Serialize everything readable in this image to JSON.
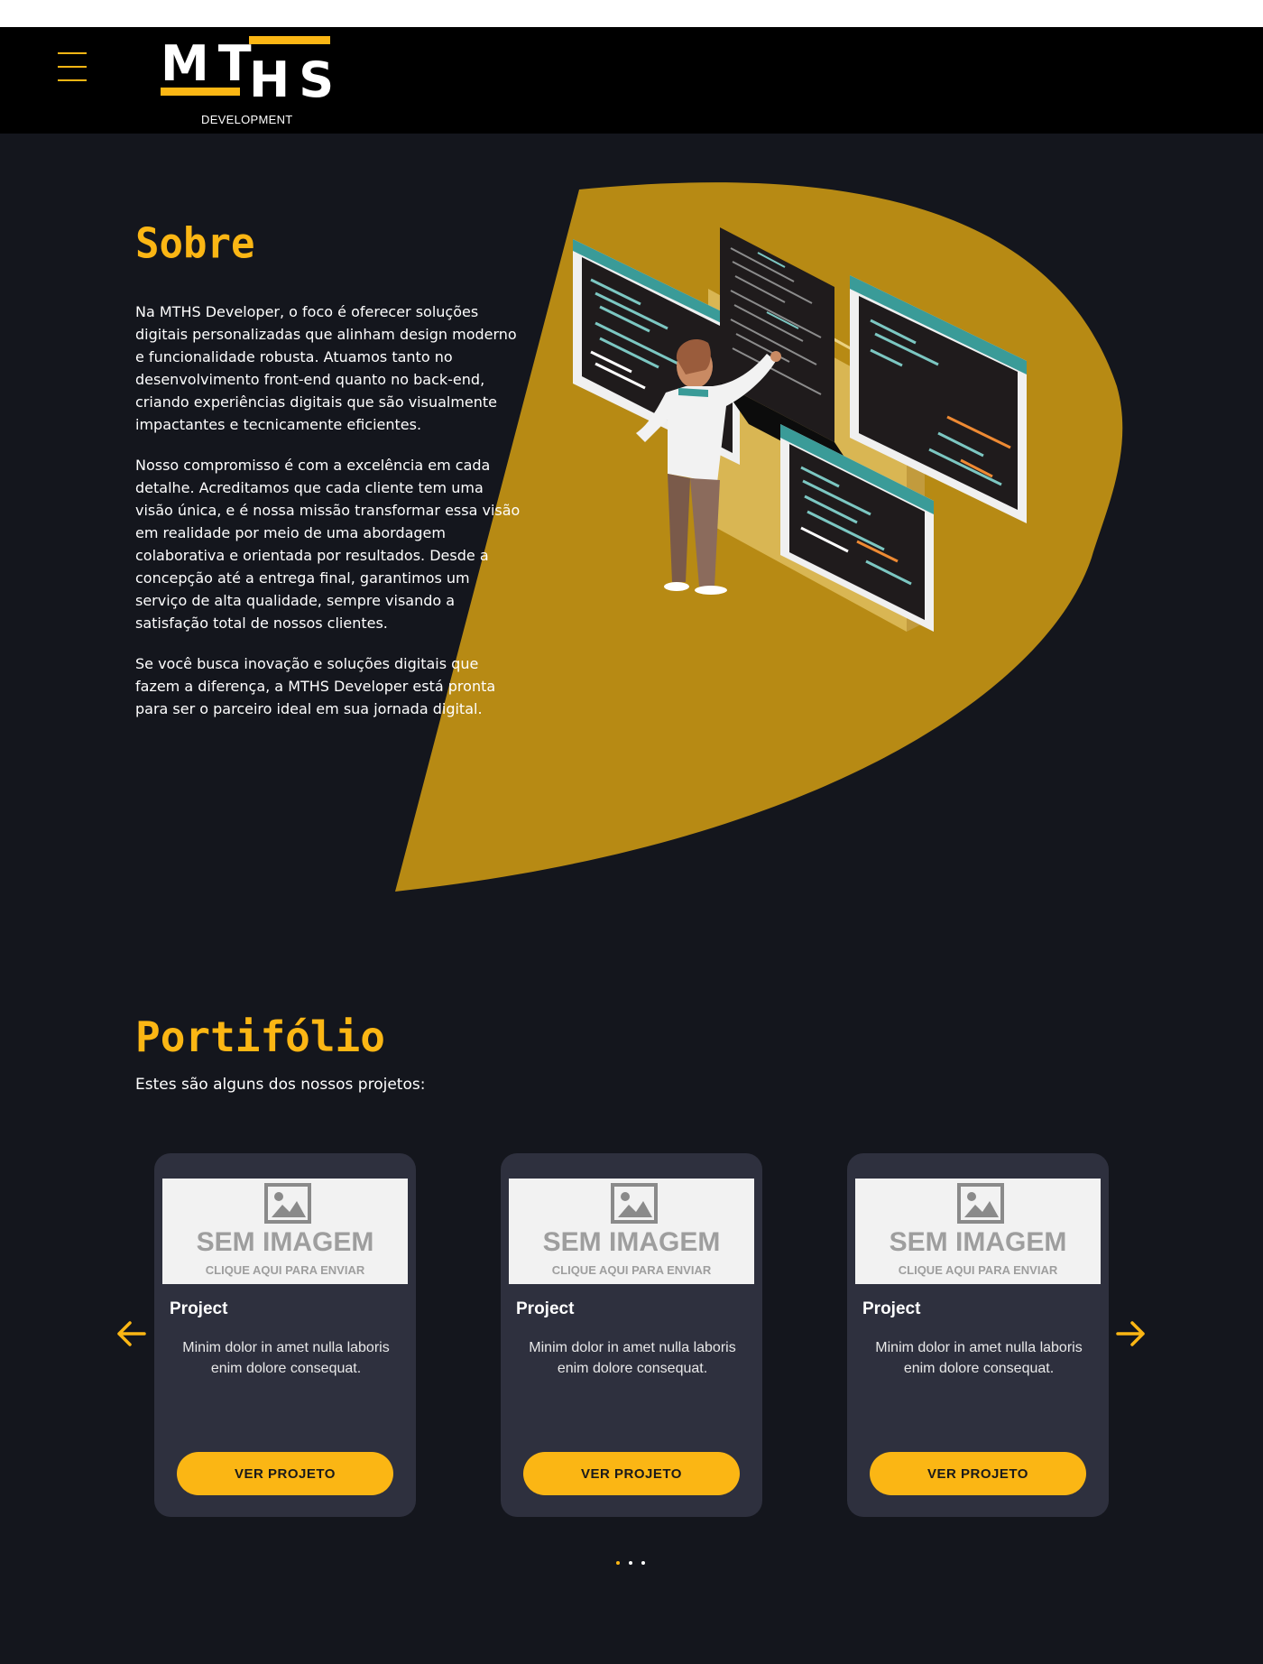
{
  "header": {
    "logo_mt": "MT",
    "logo_hs": "HS",
    "logo_subtitle": "DEVELOPMENT"
  },
  "sobre": {
    "title": "Sobre",
    "paragraphs": [
      "Na MTHS Developer, o foco é oferecer soluções digitais personalizadas que alinham design moderno e funcionalidade robusta. Atuamos tanto no desenvolvimento front-end quanto no back-end, criando experiências digitais que são visualmente impactantes e tecnicamente eficientes.",
      "Nosso compromisso é com a excelência em cada detalhe. Acreditamos que cada cliente tem uma visão única, e é nossa missão transformar essa visão em realidade por meio de uma abordagem colaborativa e orientada por resultados. Desde a concepção até a entrega final, garantimos um serviço de alta qualidade, sempre visando a satisfação total de nossos clientes.",
      "Se você busca inovação e soluções digitais que fazem a diferença, a MTHS Developer está pronta para ser o parceiro ideal em sua jornada digital."
    ]
  },
  "portfolio": {
    "title": "Portifólio",
    "subtitle": "Estes são alguns dos nossos projetos:",
    "cards": [
      {
        "image_title": "SEM IMAGEM",
        "image_sub": "CLIQUE AQUI PARA ENVIAR",
        "title": "Project",
        "desc": "Minim dolor in amet nulla laboris enim dolore consequat.",
        "button": "VER PROJETO"
      },
      {
        "image_title": "SEM IMAGEM",
        "image_sub": "CLIQUE AQUI PARA ENVIAR",
        "title": "Project",
        "desc": "Minim dolor in amet nulla laboris enim dolore consequat.",
        "button": "VER PROJETO"
      },
      {
        "image_title": "SEM IMAGEM",
        "image_sub": "CLIQUE AQUI PARA ENVIAR",
        "title": "Project",
        "desc": "Minim dolor in amet nulla laboris enim dolore consequat.",
        "button": "VER PROJETO"
      }
    ],
    "carousel_page_count": 3,
    "carousel_active_index": 0
  },
  "colors": {
    "accent": "#fbb614",
    "blob": "#b78a14",
    "background": "#14161d",
    "header_bg": "#000000",
    "card_bg": "#2e303e"
  },
  "icons": {
    "menu": "hamburger-menu-icon",
    "prev": "arrow-left-icon",
    "next": "arrow-right-icon",
    "image_placeholder": "image-placeholder-icon"
  }
}
